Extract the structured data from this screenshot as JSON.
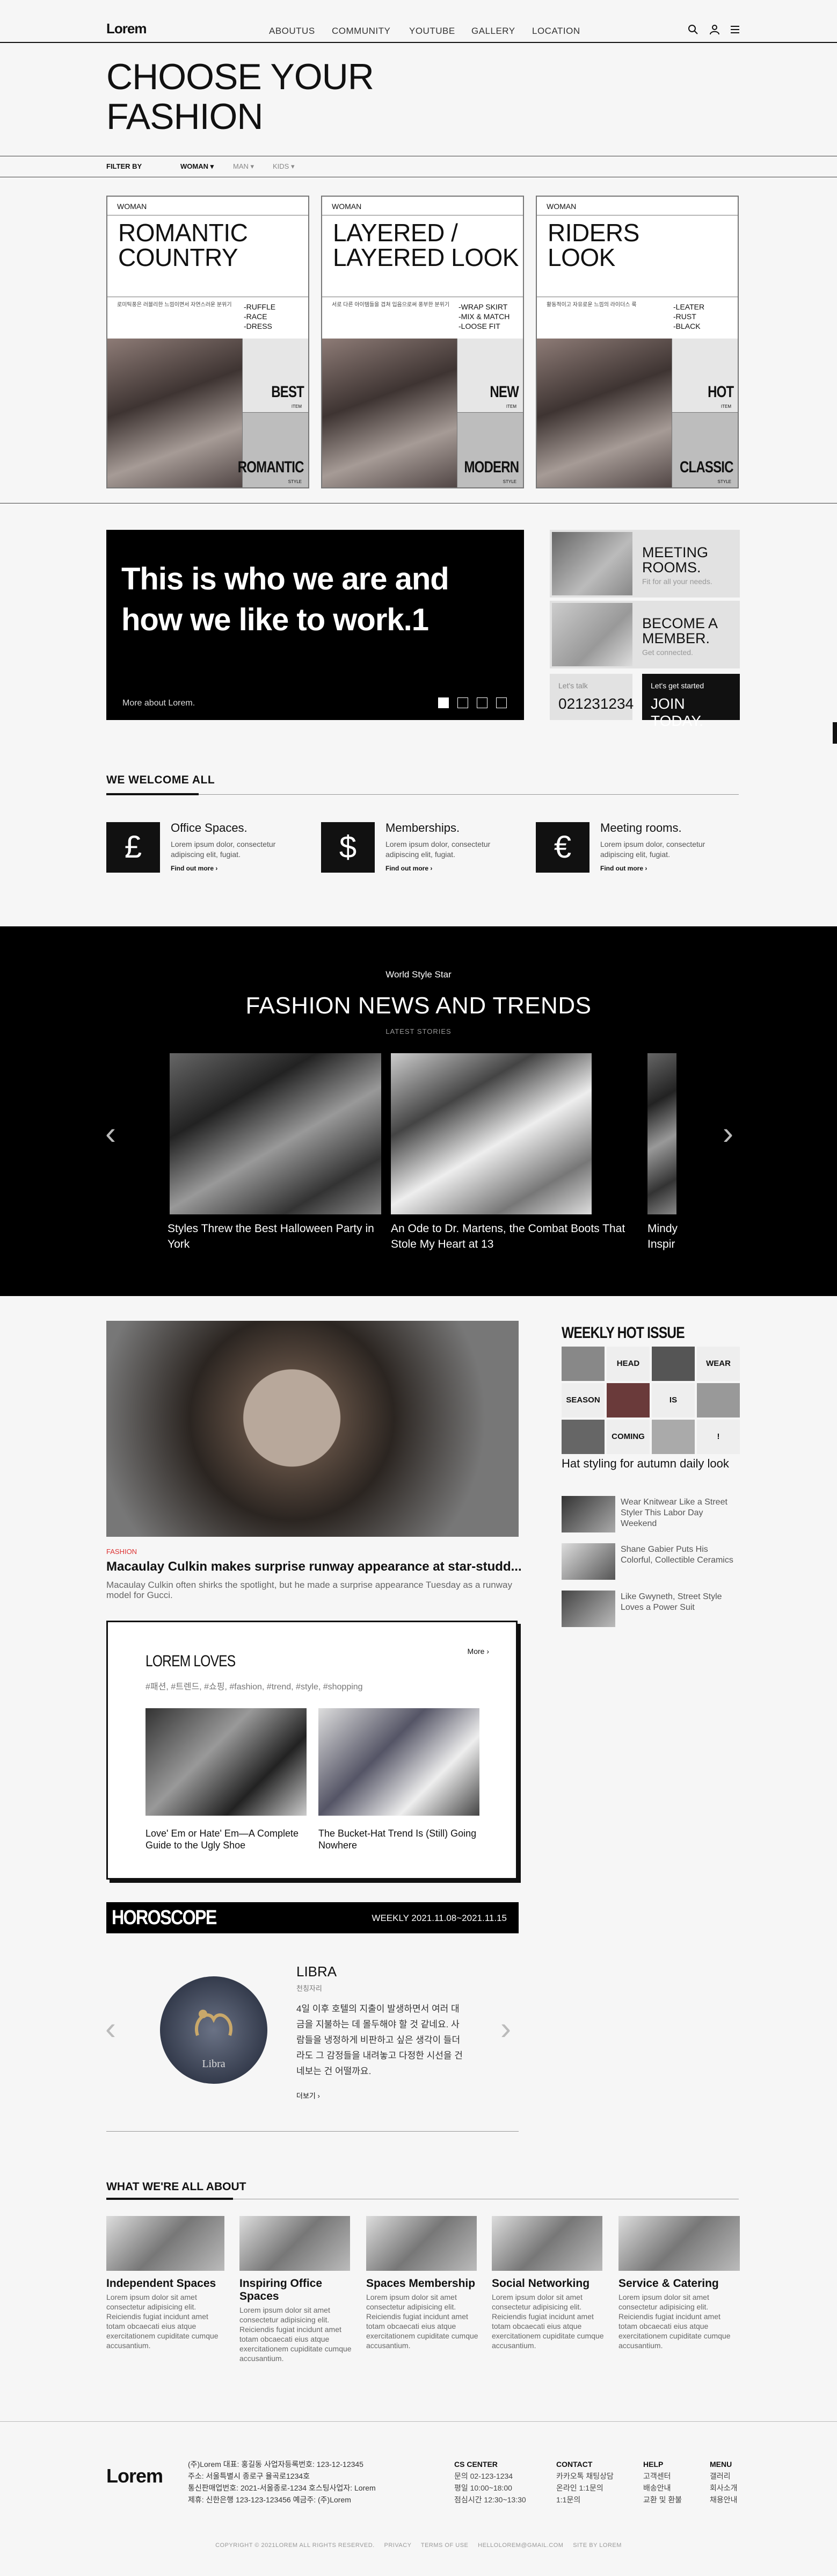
{
  "header": {
    "logo": "Lorem",
    "nav": [
      "ABOUTUS",
      "COMMUNITY",
      "YOUTUBE",
      "GALLERY",
      "LOCATION"
    ]
  },
  "hero": {
    "title_line1": "CHOOSE YOUR",
    "title_line2": "FASHION"
  },
  "filter": {
    "label": "FILTER BY",
    "options": [
      "WOMAN",
      "MAN",
      "KIDS"
    ]
  },
  "cards": [
    {
      "tag": "WOMAN",
      "title": "ROMANTIC COUNTRY",
      "bullets": "-RUFFLE\n-RACE\n-DRESS",
      "desc": "로미틱풍은 러블리한 느낌이면서 자연스러운 분위기",
      "b1": "BEST",
      "b1s": "ITEM",
      "b2": "ROMANTIC",
      "b2s": "STYLE"
    },
    {
      "tag": "WOMAN",
      "title": "LAYERED / LAYERED LOOK",
      "bullets": "-WRAP SKIRT\n-MIX & MATCH\n-LOOSE FIT",
      "desc": "서로 다른 아이템들을 겹쳐 입음으로써 풍부한 분위기",
      "b1": "NEW",
      "b1s": "ITEM",
      "b2": "MODERN",
      "b2s": "STYLE"
    },
    {
      "tag": "WOMAN",
      "title": "RIDERS LOOK",
      "bullets": "-LEATER\n-RUST\n-BLACK",
      "desc": "활동적이고 자유로운 느낌의 라이더스 룩",
      "b1": "HOT",
      "b1s": "ITEM",
      "b2": "CLASSIC",
      "b2s": "STYLE"
    }
  ],
  "about": {
    "title": "This is who we are and how we like to work.1",
    "link": "More about Lorem.",
    "side": [
      {
        "title": "MEETING ROOMS.",
        "sub": "Fit for all your needs."
      },
      {
        "title": "BECOME A MEMBER.",
        "sub": "Get connected."
      }
    ],
    "talk_label": "Let's talk",
    "phone": "021231234",
    "started_label": "Let's get started",
    "join": "JOIN TODAY."
  },
  "welcome": {
    "heading": "WE WELCOME ALL",
    "items": [
      {
        "icon": "pound-icon",
        "glyph": "£",
        "title": "Office Spaces.",
        "desc": "Lorem ipsum dolor, consectetur adipiscing elit, fugiat.",
        "link": "Find out more"
      },
      {
        "icon": "dollar-icon",
        "glyph": "$",
        "title": "Memberships.",
        "desc": "Lorem ipsum dolor, consectetur adipiscing elit, fugiat.",
        "link": "Find out more"
      },
      {
        "icon": "euro-icon",
        "glyph": "€",
        "title": "Meeting rooms.",
        "desc": "Lorem ipsum dolor, consectetur adipiscing elit, fugiat.",
        "link": "Find out more"
      }
    ]
  },
  "news": {
    "small": "World Style Star",
    "title": "FASHION NEWS AND TRENDS",
    "label": "LATEST STORIES",
    "captions": [
      "Styles Threw the Best Halloween Party in York",
      "An Ode to Dr. Martens, the Combat Boots That Stole My Heart at 13",
      "Mindy Inspir"
    ]
  },
  "main_story": {
    "category": "FASHION",
    "headline": "Macaulay Culkin makes surprise runway appearance at star-studd...",
    "desc": "Macaulay Culkin often shirks the spotlight, but he made a surprise appearance Tuesday as a runway model for Gucci."
  },
  "loves": {
    "title": "LOREM LOVES",
    "more": "More",
    "tags": "#패션, #트렌드, #쇼핑, #fashion, #trend, #style, #shopping",
    "items": [
      "Love' Em or Hate' Em—A Complete Guide to the Ugly Shoe",
      "The Bucket-Hat Trend Is (Still) Going Nowhere"
    ]
  },
  "horoscope": {
    "title": "HOROSCOPE",
    "week": "WEEKLY 2021.11.08~2021.11.15",
    "sign": "LIBRA",
    "sign_sub": "천칭자리",
    "desc": "4일 이후 호텔의 지출이 발생하면서 여러 대금을 지불하는 데 몰두해야 할 것 같네요. 사람들을 냉정하게 비판하고 싶은 생각이 들더라도 그 감정들을 내려놓고 다정한 시선을 건네보는 건 어떨까요.",
    "more": "더보기",
    "emblem": "Libra"
  },
  "hot_issue": {
    "title": "WEEKLY HOT ISSUE",
    "grid_words": [
      "HEAD",
      "WEAR",
      "SEASON",
      "IS",
      "COMING",
      "!"
    ],
    "headline": "Hat styling for autumn daily look",
    "list": [
      "Wear Knitwear Like a Street Styler This Labor Day Weekend",
      "Shane Gabier Puts His Colorful, Collectible Ceramics",
      "Like Gwyneth, Street Style Loves a Power Suit"
    ]
  },
  "what_we_are": {
    "heading": "WHAT WE'RE ALL ABOUT",
    "items": [
      {
        "title": "Independent Spaces",
        "desc": "Lorem ipsum dolor sit amet consectetur adipisicing elit. Reiciendis fugiat incidunt amet totam obcaecati eius atque exercitationem cupiditate cumque accusantium."
      },
      {
        "title": "Inspiring Office Spaces",
        "desc": "Lorem ipsum dolor sit amet consectetur adipisicing elit. Reiciendis fugiat incidunt amet totam obcaecati eius atque exercitationem cupiditate cumque accusantium."
      },
      {
        "title": "Spaces Membership",
        "desc": "Lorem ipsum dolor sit amet consectetur adipisicing elit. Reiciendis fugiat incidunt amet totam obcaecati eius atque exercitationem cupiditate cumque accusantium."
      },
      {
        "title": "Social Networking",
        "desc": "Lorem ipsum dolor sit amet consectetur adipisicing elit. Reiciendis fugiat incidunt amet totam obcaecati eius atque exercitationem cupiditate cumque accusantium."
      },
      {
        "title": "Service & Catering",
        "desc": "Lorem ipsum dolor sit amet consectetur adipisicing elit. Reiciendis fugiat incidunt amet totam obcaecati eius atque exercitationem cupiditate cumque accusantium."
      }
    ]
  },
  "footer": {
    "logo": "Lorem",
    "info": "(주)Lorem 대표: 홍길동 사업자등록번호: 123-12-12345\n주소: 서울특별시 종로구 율곡로1234호\n통신판매업번호: 2021-서울종로-1234 호스팅사업자: Lorem\n제휴: 신한은행 123-123-123456 예금주: (주)Lorem",
    "cols": [
      {
        "title": "CS CENTER",
        "lines": "문의 02-123-1234\n평일 10:00~18:00\n점심시간 12:30~13:30"
      },
      {
        "title": "CONTACT",
        "lines": "카카오톡 채팅상담\n온라인 1:1문의\n1:1문의"
      },
      {
        "title": "HELP",
        "lines": "고객센터\n배송안내\n교환 및 환불"
      },
      {
        "title": "MENU",
        "lines": "갤러리\n회사소개\n채용안내"
      }
    ],
    "copyright": "COPYRIGHT © 2021LOREM ALL RIGHTS RESERVED.     PRIVACY     TERMS OF USE     HELLOLOREM@GMAIL.COM     SITE BY LOREM"
  },
  "colors": {
    "accent": "#d33333",
    "dark": "#000000",
    "panel": "#e2e2e2"
  }
}
